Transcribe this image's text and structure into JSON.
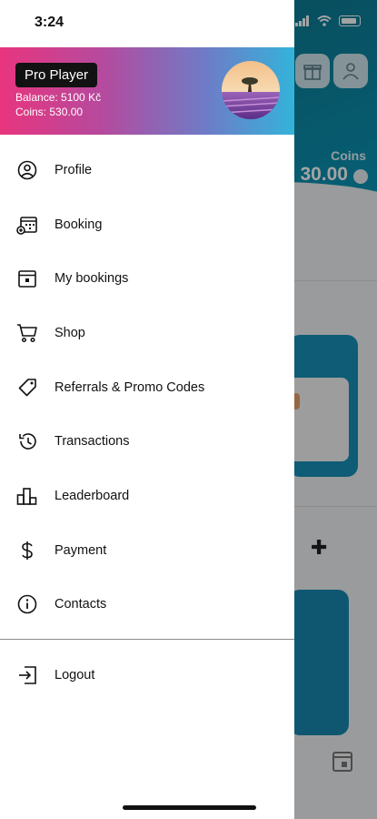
{
  "status_bar": {
    "time": "3:24"
  },
  "profile": {
    "name": "Pro Player",
    "balance": "Balance: 5100 Kč",
    "coins": "Coins: 530.00"
  },
  "menu": {
    "items": [
      {
        "label": "Profile",
        "icon": "user-circle-icon"
      },
      {
        "label": "Booking",
        "icon": "calendar-add-icon"
      },
      {
        "label": "My bookings",
        "icon": "calendar-icon"
      },
      {
        "label": "Shop",
        "icon": "cart-icon"
      },
      {
        "label": "Referrals & Promo Codes",
        "icon": "tag-icon"
      },
      {
        "label": "Transactions",
        "icon": "history-icon"
      },
      {
        "label": "Leaderboard",
        "icon": "leaderboard-icon"
      },
      {
        "label": "Payment",
        "icon": "dollar-icon"
      },
      {
        "label": "Contacts",
        "icon": "info-icon"
      }
    ],
    "logout": {
      "label": "Logout",
      "icon": "logout-icon"
    }
  },
  "background": {
    "coins_label": "Coins",
    "coins_value": "30.00"
  },
  "colors": {
    "header_gradient": [
      "#e8357e",
      "#b54a9e",
      "#6e7cc7",
      "#33b3da"
    ],
    "background_hero": "#0c8aa7",
    "badge": "#121212"
  }
}
